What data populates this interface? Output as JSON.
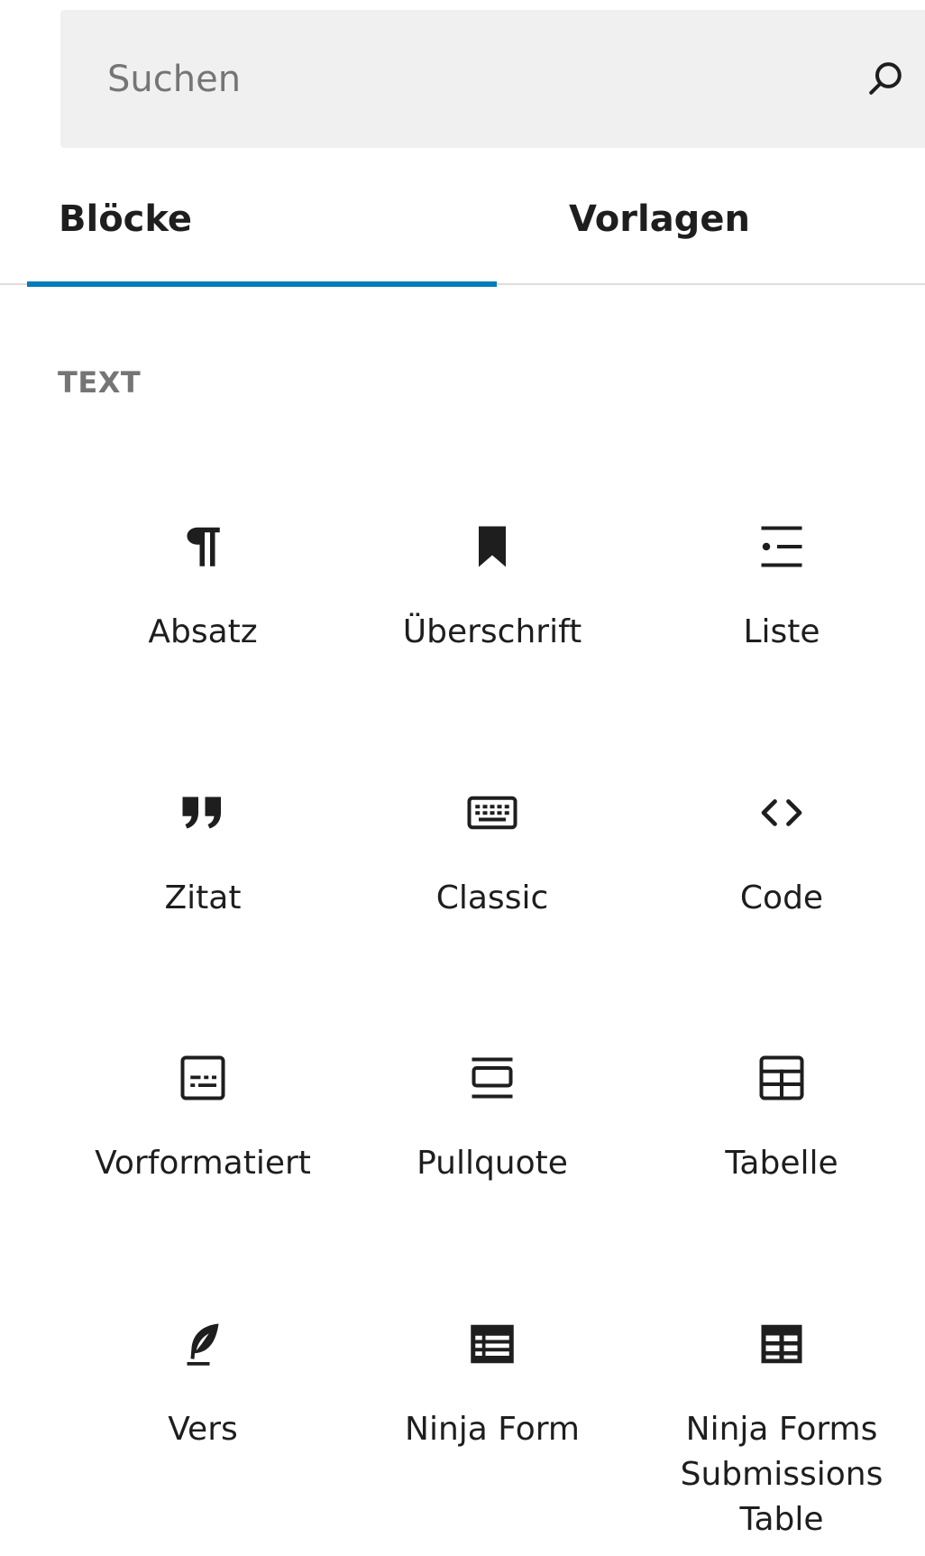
{
  "search": {
    "placeholder": "Suchen"
  },
  "tabs": [
    {
      "label": "Blöcke",
      "active": true
    },
    {
      "label": "Vorlagen",
      "active": false
    }
  ],
  "accent_color": "#007cba",
  "category": {
    "label": "TEXT"
  },
  "blocks": [
    {
      "label": "Absatz",
      "icon": "paragraph-icon"
    },
    {
      "label": "Überschrift",
      "icon": "heading-bookmark-icon"
    },
    {
      "label": "Liste",
      "icon": "list-icon"
    },
    {
      "label": "Zitat",
      "icon": "quote-icon"
    },
    {
      "label": "Classic",
      "icon": "keyboard-icon"
    },
    {
      "label": "Code",
      "icon": "code-icon"
    },
    {
      "label": "Vorformatiert",
      "icon": "preformatted-icon"
    },
    {
      "label": "Pullquote",
      "icon": "pullquote-icon"
    },
    {
      "label": "Tabelle",
      "icon": "table-icon"
    },
    {
      "label": "Vers",
      "icon": "verse-feather-icon"
    },
    {
      "label": "Ninja Form",
      "icon": "ninja-form-icon"
    },
    {
      "label": "Ninja Forms Submissions Table",
      "icon": "submissions-table-icon"
    }
  ]
}
